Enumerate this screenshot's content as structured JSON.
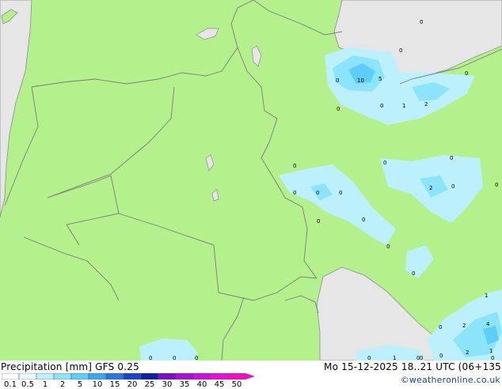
{
  "map": {
    "value_labels": [
      "0",
      "10",
      "5",
      "0",
      "0",
      "1",
      "2",
      "0",
      "0",
      "0",
      "0",
      "2",
      "0",
      "0",
      "0",
      "0",
      "0",
      "0",
      "0",
      "0",
      "0",
      "0",
      "0",
      "1",
      "2",
      "4",
      "0",
      "2",
      "1",
      "0",
      "0",
      "1",
      "0",
      "0",
      "0",
      "0",
      "0",
      "0"
    ]
  },
  "footer": {
    "title": "Precipitation [mm]  GFS 0.25",
    "datetime": "Mo 15-12-2025 18..21 UTC (06+135",
    "credit": "©weatheronline.co.uk",
    "scale_labels": [
      "0.1",
      "0.5",
      "1",
      "2",
      "5",
      "10",
      "15",
      "20",
      "25",
      "30",
      "35",
      "40",
      "45",
      "50"
    ],
    "scale_colors": [
      "#fefefe",
      "#e6fafe",
      "#bcf0fc",
      "#8ce4fa",
      "#5ccef8",
      "#3ca6f0",
      "#2c74e0",
      "#1a44c8",
      "#1020a0",
      "#7a10c8",
      "#a810d8",
      "#cc10e0",
      "#e410d8",
      "#f010c0"
    ]
  },
  "colors": {
    "land": "#b4f08c",
    "sea": "#e6e6e6",
    "border": "#7c7c7c"
  }
}
